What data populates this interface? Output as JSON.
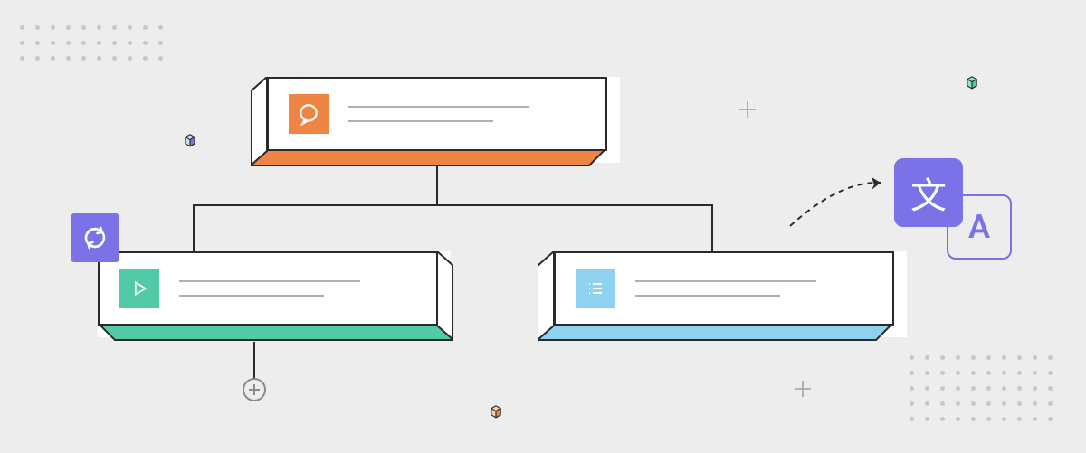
{
  "cards": {
    "top": {
      "icon": "chat-icon",
      "icon_color": "#ef8545",
      "side_color": "#ef8545"
    },
    "left": {
      "icon": "play-icon",
      "icon_color": "#52c9a7",
      "side_color": "#52c9a7"
    },
    "right": {
      "icon": "list-icon",
      "icon_color": "#8fd2f0",
      "side_color": "#8fd2f0"
    }
  },
  "decorations": {
    "refresh_badge": "refresh-icon",
    "add_button": "add-icon",
    "translate": {
      "primary_glyph": "文",
      "secondary_glyph": "A"
    },
    "cubes": [
      "cube-icon",
      "cube-icon",
      "cube-icon"
    ],
    "crosses": [
      "plus-icon",
      "plus-icon"
    ]
  },
  "colors": {
    "purple": "#7b72e8",
    "orange": "#ef8545",
    "teal": "#52c9a7",
    "skyblue": "#8fd2f0",
    "outline": "#2a2a2a",
    "bg": "#ededed"
  }
}
